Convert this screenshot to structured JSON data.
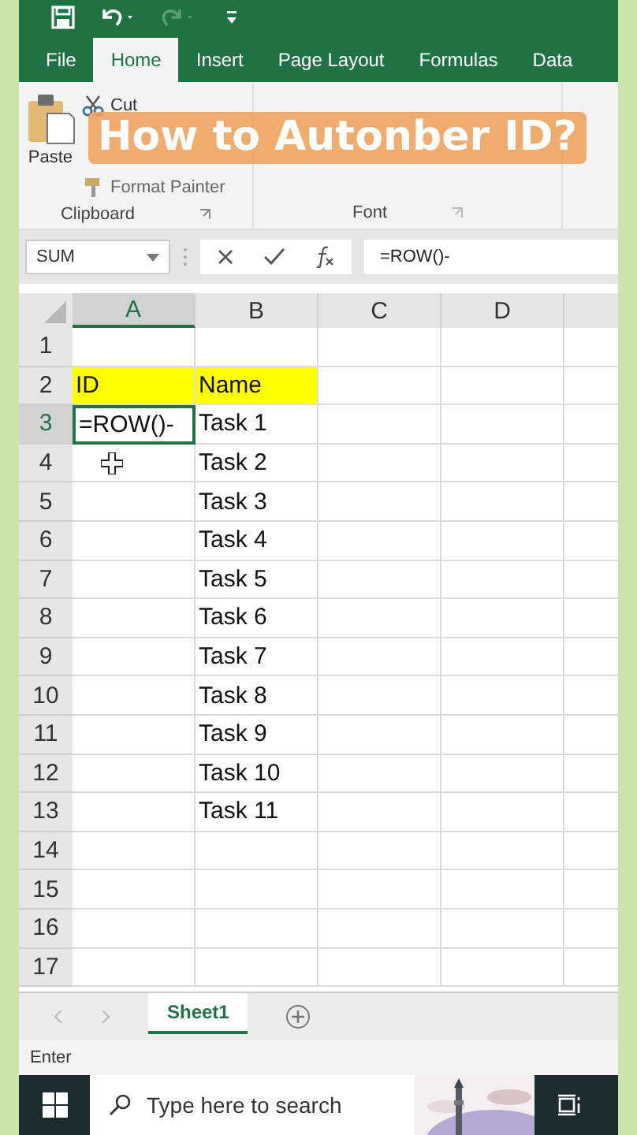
{
  "tabs": [
    {
      "label": "File",
      "selected": false
    },
    {
      "label": "Home",
      "selected": true
    },
    {
      "label": "Insert",
      "selected": false
    },
    {
      "label": "Page Layout",
      "selected": false
    },
    {
      "label": "Formulas",
      "selected": false
    },
    {
      "label": "Data",
      "selected": false
    }
  ],
  "ribbon": {
    "paste": "Paste",
    "cut": "Cut",
    "format_painter": "Format Painter",
    "clipboard_label": "Clipboard",
    "font_label": "Font"
  },
  "overlay_title": "How to Autonber ID?",
  "name_box": "SUM",
  "formula": "=ROW()-",
  "columns": [
    {
      "label": "A",
      "selected": true
    },
    {
      "label": "B",
      "selected": false
    },
    {
      "label": "C",
      "selected": false
    },
    {
      "label": "D",
      "selected": false
    }
  ],
  "rows": [
    {
      "number": "1",
      "highlighted": false,
      "active": false
    },
    {
      "number": "2",
      "a": "ID",
      "b": "Name",
      "highlighted": true,
      "active": false
    },
    {
      "number": "3",
      "a": "=ROW()-",
      "b": "Task 1",
      "highlighted": false,
      "active": true
    },
    {
      "number": "4",
      "b": "Task 2",
      "highlighted": false,
      "active": false
    },
    {
      "number": "5",
      "b": "Task 3",
      "highlighted": false,
      "active": false
    },
    {
      "number": "6",
      "b": "Task 4",
      "highlighted": false,
      "active": false
    },
    {
      "number": "7",
      "b": "Task 5",
      "highlighted": false,
      "active": false
    },
    {
      "number": "8",
      "b": "Task 6",
      "highlighted": false,
      "active": false
    },
    {
      "number": "9",
      "b": "Task 7",
      "highlighted": false,
      "active": false
    },
    {
      "number": "10",
      "b": "Task 8",
      "highlighted": false,
      "active": false
    },
    {
      "number": "11",
      "b": "Task 9",
      "highlighted": false,
      "active": false
    },
    {
      "number": "12",
      "b": "Task 10",
      "highlighted": false,
      "active": false
    },
    {
      "number": "13",
      "b": "Task 11",
      "highlighted": false,
      "active": false
    },
    {
      "number": "14",
      "highlighted": false,
      "active": false
    },
    {
      "number": "15",
      "highlighted": false,
      "active": false
    },
    {
      "number": "16",
      "highlighted": false,
      "active": false
    },
    {
      "number": "17",
      "highlighted": false,
      "active": false
    }
  ],
  "sheets": [
    {
      "label": "Sheet1",
      "selected": true
    }
  ],
  "status": "Enter",
  "taskbar": {
    "search_placeholder": "Type here to search"
  }
}
